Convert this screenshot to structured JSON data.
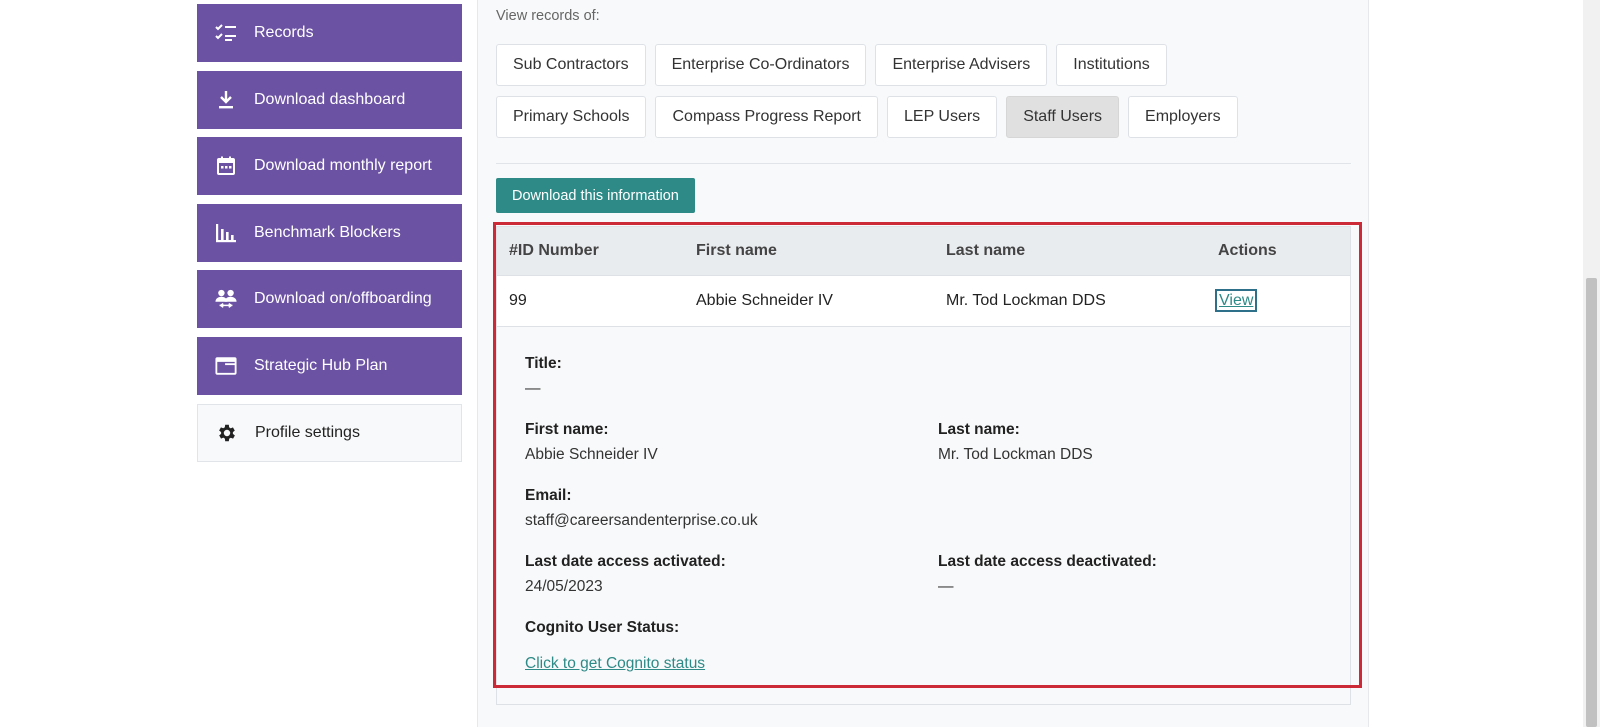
{
  "sidebar": {
    "items": [
      {
        "label": "Records",
        "icon": "checklist-icon"
      },
      {
        "label": "Download dashboard",
        "icon": "download-icon"
      },
      {
        "label": "Download monthly report",
        "icon": "calendar-icon"
      },
      {
        "label": "Benchmark Blockers",
        "icon": "bar-chart-icon"
      },
      {
        "label": "Download on/offboarding",
        "icon": "people-icon"
      },
      {
        "label": "Strategic Hub Plan",
        "icon": "window-icon"
      }
    ],
    "profile": {
      "label": "Profile settings",
      "icon": "gear-icon"
    }
  },
  "main": {
    "view_label": "View records of:",
    "filters_row1": [
      "Sub Contractors",
      "Enterprise Co-Ordinators",
      "Enterprise Advisers",
      "Institutions"
    ],
    "filters_row2": [
      "Primary Schools",
      "Compass Progress Report",
      "LEP Users",
      "Staff Users",
      "Employers"
    ],
    "active_filter": "Staff Users",
    "download_label": "Download this information",
    "table": {
      "headers": [
        "#ID Number",
        "First name",
        "Last name",
        "Actions"
      ],
      "row": {
        "id": "99",
        "first_name": "Abbie Schneider IV",
        "last_name": "Mr. Tod Lockman DDS",
        "action": "View"
      }
    },
    "details": {
      "title_label": "Title:",
      "title_value": "—",
      "first_name_label": "First name:",
      "first_name_value": "Abbie Schneider IV",
      "last_name_label": "Last name:",
      "last_name_value": "Mr. Tod Lockman DDS",
      "email_label": "Email:",
      "email_value": "staff@careersandenterprise.co.uk",
      "activated_label": "Last date access activated:",
      "activated_value": "24/05/2023",
      "deactivated_label": "Last date access deactivated:",
      "deactivated_value": "—",
      "cognito_label": "Cognito User Status:",
      "cognito_link": "Click to get Cognito status"
    }
  },
  "colors": {
    "sidebar_purple": "#6b52a3",
    "teal": "#2e8a87",
    "highlight_red": "#cc2a36"
  }
}
